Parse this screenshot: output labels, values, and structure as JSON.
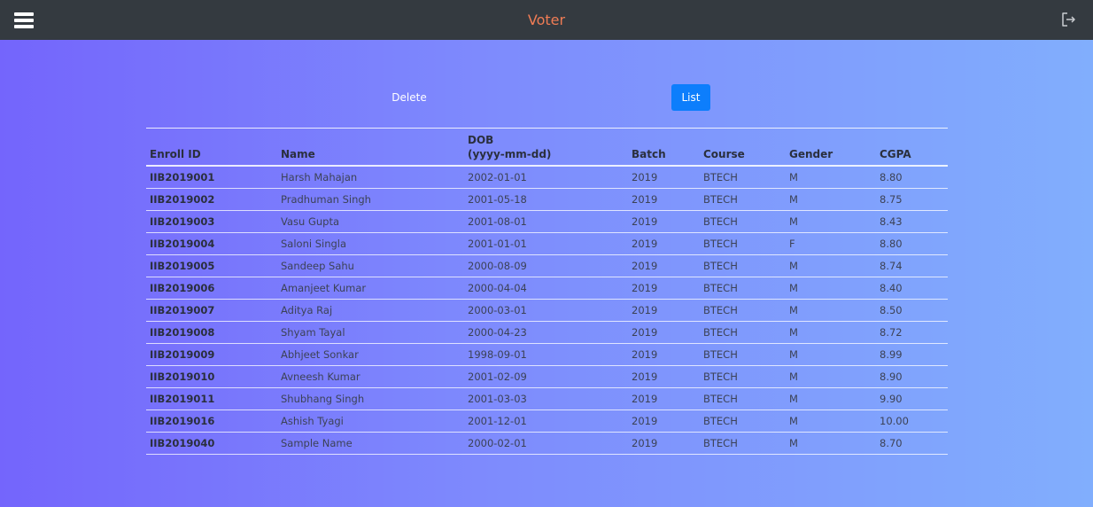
{
  "header": {
    "title": "Voter",
    "title_color": "#f07c55",
    "menu_icon": "hamburger-menu-icon",
    "logout_icon": "logout-icon"
  },
  "actions": {
    "delete_label": "Delete",
    "list_label": "List",
    "list_button_color": "#0d7efc"
  },
  "table": {
    "headers": {
      "enroll_id": "Enroll ID",
      "name": "Name",
      "dob_line1": "DOB",
      "dob_line2": "(yyyy-mm-dd)",
      "batch": "Batch",
      "course": "Course",
      "gender": "Gender",
      "cgpa": "CGPA"
    },
    "rows": [
      {
        "enroll_id": "IIB2019001",
        "name": "Harsh Mahajan",
        "dob": "2002-01-01",
        "batch": "2019",
        "course": "BTECH",
        "gender": "M",
        "cgpa": "8.80"
      },
      {
        "enroll_id": "IIB2019002",
        "name": "Pradhuman Singh",
        "dob": "2001-05-18",
        "batch": "2019",
        "course": "BTECH",
        "gender": "M",
        "cgpa": "8.75"
      },
      {
        "enroll_id": "IIB2019003",
        "name": "Vasu Gupta",
        "dob": "2001-08-01",
        "batch": "2019",
        "course": "BTECH",
        "gender": "M",
        "cgpa": "8.43"
      },
      {
        "enroll_id": "IIB2019004",
        "name": "Saloni Singla",
        "dob": "2001-01-01",
        "batch": "2019",
        "course": "BTECH",
        "gender": "F",
        "cgpa": "8.80"
      },
      {
        "enroll_id": "IIB2019005",
        "name": "Sandeep Sahu",
        "dob": "2000-08-09",
        "batch": "2019",
        "course": "BTECH",
        "gender": "M",
        "cgpa": "8.74"
      },
      {
        "enroll_id": "IIB2019006",
        "name": "Amanjeet Kumar",
        "dob": "2000-04-04",
        "batch": "2019",
        "course": "BTECH",
        "gender": "M",
        "cgpa": "8.40"
      },
      {
        "enroll_id": "IIB2019007",
        "name": "Aditya Raj",
        "dob": "2000-03-01",
        "batch": "2019",
        "course": "BTECH",
        "gender": "M",
        "cgpa": "8.50"
      },
      {
        "enroll_id": "IIB2019008",
        "name": "Shyam Tayal",
        "dob": "2000-04-23",
        "batch": "2019",
        "course": "BTECH",
        "gender": "M",
        "cgpa": "8.72"
      },
      {
        "enroll_id": "IIB2019009",
        "name": "Abhjeet Sonkar",
        "dob": "1998-09-01",
        "batch": "2019",
        "course": "BTECH",
        "gender": "M",
        "cgpa": "8.99"
      },
      {
        "enroll_id": "IIB2019010",
        "name": "Avneesh Kumar",
        "dob": "2001-02-09",
        "batch": "2019",
        "course": "BTECH",
        "gender": "M",
        "cgpa": "8.90"
      },
      {
        "enroll_id": "IIB2019011",
        "name": "Shubhang Singh",
        "dob": "2001-03-03",
        "batch": "2019",
        "course": "BTECH",
        "gender": "M",
        "cgpa": "9.90"
      },
      {
        "enroll_id": "IIB2019016",
        "name": "Ashish Tyagi",
        "dob": "2001-12-01",
        "batch": "2019",
        "course": "BTECH",
        "gender": "M",
        "cgpa": "10.00"
      },
      {
        "enroll_id": "IIB2019040",
        "name": "Sample Name",
        "dob": "2000-02-01",
        "batch": "2019",
        "course": "BTECH",
        "gender": "M",
        "cgpa": "8.70"
      }
    ]
  }
}
